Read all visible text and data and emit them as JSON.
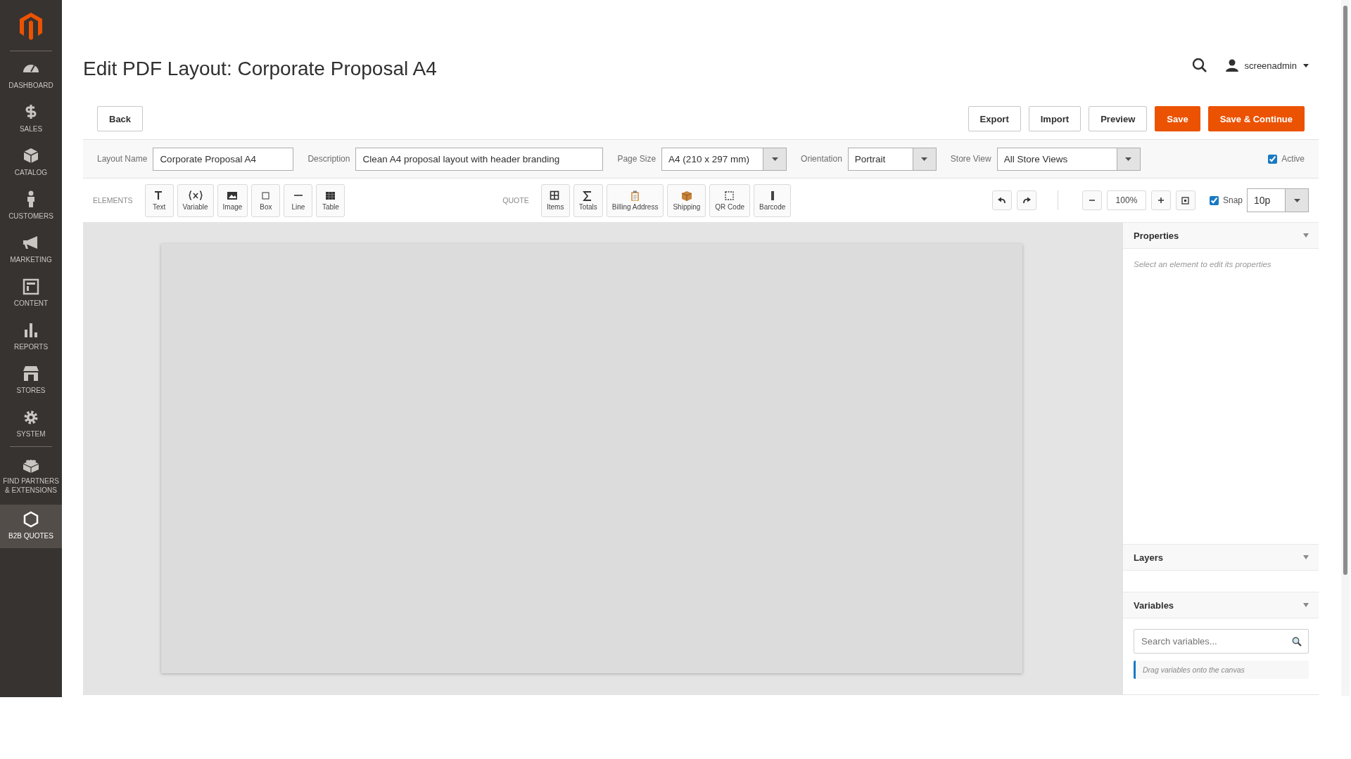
{
  "sidebar": {
    "items": [
      {
        "label": "DASHBOARD",
        "selected": false
      },
      {
        "label": "SALES",
        "selected": false
      },
      {
        "label": "CATALOG",
        "selected": false
      },
      {
        "label": "CUSTOMERS",
        "selected": false
      },
      {
        "label": "MARKETING",
        "selected": false
      },
      {
        "label": "CONTENT",
        "selected": false
      },
      {
        "label": "REPORTS",
        "selected": false
      },
      {
        "label": "STORES",
        "selected": false
      },
      {
        "label": "SYSTEM",
        "selected": false
      },
      {
        "label": "FIND PARTNERS & EXTENSIONS",
        "selected": false
      },
      {
        "label": "B2B QUOTES",
        "selected": true
      }
    ]
  },
  "page_title": "Edit PDF Layout: Corporate Proposal A4",
  "user": {
    "name": "screenadmin"
  },
  "actions": [
    {
      "label": "Back",
      "kind": "secondary"
    },
    {
      "label": "Export",
      "kind": "secondary"
    },
    {
      "label": "Import",
      "kind": "secondary"
    },
    {
      "label": "Preview",
      "kind": "secondary"
    },
    {
      "label": "Save",
      "kind": "primary"
    },
    {
      "label": "Save & Continue",
      "kind": "primary"
    }
  ],
  "form": {
    "fields": [
      {
        "label": "Layout Name",
        "kind": "input",
        "value": "Corporate Proposal A4"
      },
      {
        "label": "Description",
        "kind": "input",
        "value": "Clean A4 proposal layout with header branding"
      },
      {
        "label": "Page Size",
        "kind": "select",
        "value": "A4 (210 x 297 mm)"
      },
      {
        "label": "Orientation",
        "kind": "select",
        "value": "Portrait"
      },
      {
        "label": "Store View",
        "kind": "select",
        "value": "All Store Views"
      }
    ],
    "active": {
      "label": "Active",
      "checked": true
    }
  },
  "toolbar": {
    "groups": [
      {
        "label": "ELEMENTS",
        "tools": [
          "Text",
          "Variable",
          "Image",
          "Box",
          "Line",
          "Table"
        ]
      },
      {
        "label": "QUOTE",
        "tools": [
          "Items",
          "Totals",
          "Billing Address",
          "Shipping",
          "QR Code",
          "Barcode"
        ]
      }
    ],
    "zoom": "100%",
    "snap": {
      "label": "Snap",
      "checked": true
    },
    "grid": "10p"
  },
  "panel": {
    "sections": [
      {
        "title": "Properties",
        "hint": "Select an element to edit its properties"
      },
      {
        "title": "Layers"
      },
      {
        "title": "Variables",
        "search_placeholder": "Search variables...",
        "hint": "Drag variables onto the canvas"
      }
    ]
  }
}
